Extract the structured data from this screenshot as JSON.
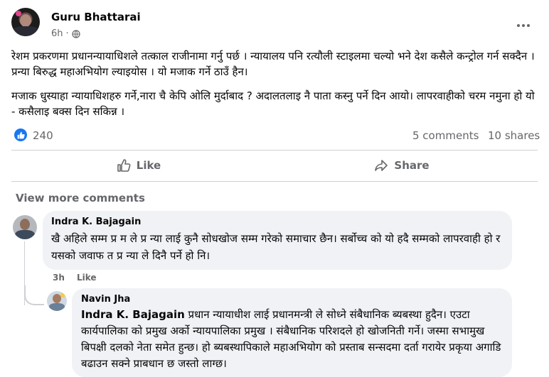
{
  "post": {
    "author": "Guru Bhattarai",
    "time": "6h",
    "paragraph1": "रेशम प्रकरणमा प्रधानन्यायाधिशले तत्काल राजीनामा गर्नु पर्छ । न्यायालय पनि रत्यौली स्टाइलमा चल्यो भने देश कसैले कन्ट्रोल गर्न सक्दैन । प्रन्या बिरुद्ध महाअभियोग ल्याइयोस । यो मजाक गर्ने ठाउँ हैन।",
    "paragraph2": "मजाक धुस्याहा न्यायाधिशहरु गर्ने,नारा चै केपि ओलि मुर्दाबाद ? अदालतलाइ नै पाता कस्नु पर्ने दिन आयो। लापरवाहीको चरम नमुना हो यो - कसैलाइ बक्स दिन सकिन्न ।",
    "reaction_count": "240",
    "comments_count": "5 comments",
    "shares_count": "10 shares"
  },
  "actions": {
    "like_label": "Like",
    "share_label": "Share"
  },
  "view_more_comments": "View more comments",
  "comments": [
    {
      "name": "Indra K. Bajagain",
      "text": "खै अहिले सम्म प्र म ले प्र न्या लाई कुनै सोधखोज सम्म गरेको समाचार छैन। सर्बोच्च को यो हदै सम्मको लापरवाही हो र यसको जवाफ त प्र न्या ले दिनै पर्ने हो नि।",
      "time": "3h",
      "like_label": "Like"
    },
    {
      "name": "Navin Jha",
      "mention": "Indra K. Bajagain",
      "text": " प्रधान न्यायाधीश लाई प्रधानमन्त्री ले सोध्ने संबैधानिक ब्यबस्था हुदैन। एउटा कार्यपालिका को प्रमुख अर्को न्यायपालिका प्रमुख । संबैधानिक परिशदले हो खोजनिती गर्ने। जस्मा सभामुख बिपक्षी दलको नेता समेत हुन्छ। हो ब्यबस्थापिकाले महाअभियोग को प्रस्ताब सन्सदमा दर्ता गरायेर प्रकृया अगाडि बढाउन सक्ने प्राबधान छ जस्तो लाग्छ।"
    }
  ],
  "colors": {
    "accent": "#1877f2",
    "secondary_text": "#65676b",
    "bubble": "#f0f2f5"
  }
}
